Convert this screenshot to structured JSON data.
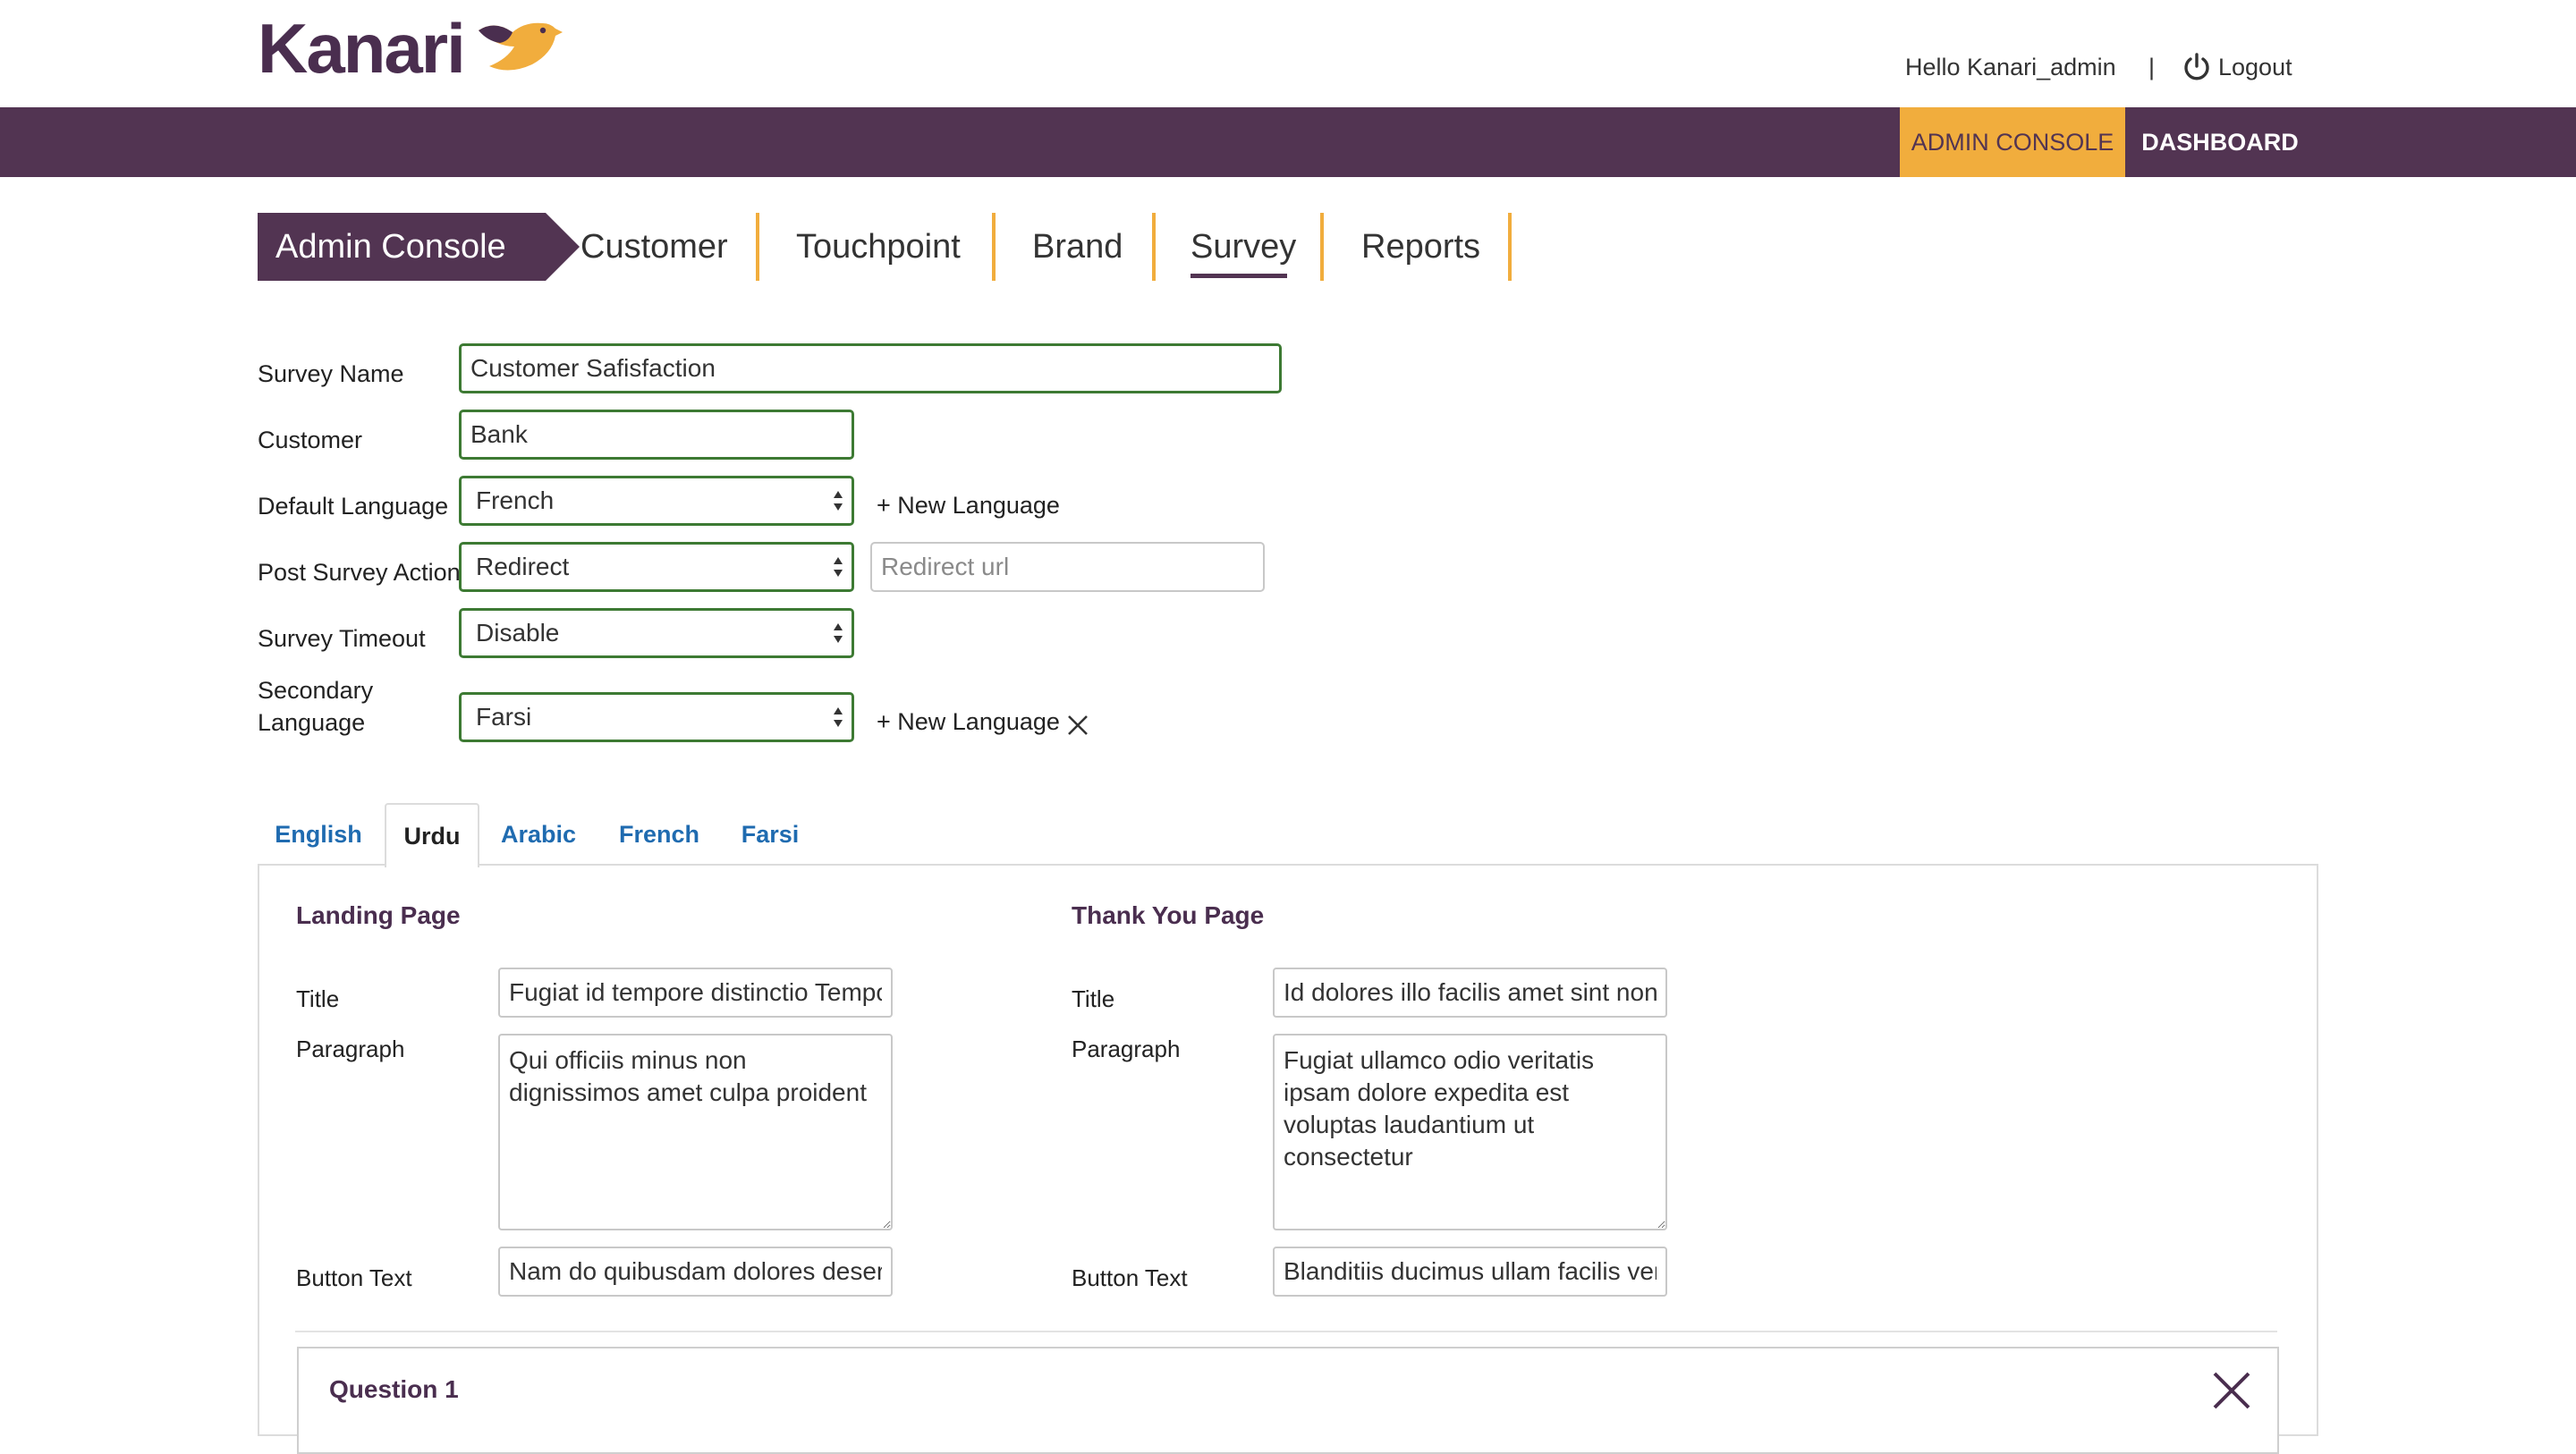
{
  "brand": {
    "logo_text": "Kanari",
    "accent": "#f1ad3d",
    "primary": "#523452",
    "valid_border": "#3d7a33",
    "link": "#1f6bb0"
  },
  "header": {
    "greeting": "Hello Kanari_admin",
    "separator": "|",
    "logout": "Logout",
    "icons": {
      "logout": "power-icon"
    }
  },
  "topnav": {
    "admin_console": "ADMIN CONSOLE",
    "dashboard": "DASHBOARD"
  },
  "subnav": {
    "breadcrumb": "Admin Console",
    "tabs": [
      "Customer",
      "Touchpoint",
      "Brand",
      "Survey",
      "Reports"
    ],
    "active_tab": "Survey"
  },
  "form": {
    "survey_name_label": "Survey Name",
    "survey_name_value": "Customer Safisfaction",
    "customer_label": "Customer",
    "customer_value": "Bank",
    "default_language_label": "Default Language",
    "default_language_value": "French",
    "new_language_link": "+ New Language",
    "post_survey_action_label": "Post Survey Action",
    "post_survey_action_value": "Redirect",
    "redirect_placeholder": "Redirect url",
    "survey_timeout_label": "Survey Timeout",
    "survey_timeout_value": "Disable",
    "secondary_language_label_1": "Secondary",
    "secondary_language_label_2": "Language",
    "secondary_language_value": "Farsi",
    "secondary_new_language_link": "+ New Language"
  },
  "language_tabs": {
    "items": [
      "English",
      "Urdu",
      "Arabic",
      "French",
      "Farsi"
    ],
    "active": "Urdu"
  },
  "landing": {
    "heading": "Landing Page",
    "title_label": "Title",
    "title_value": "Fugiat id tempore distinctio Tempor",
    "paragraph_label": "Paragraph",
    "paragraph_value": "Qui officiis minus non dignissimos amet culpa proident",
    "button_label": "Button Text",
    "button_value": "Nam do quibusdam dolores deserunt"
  },
  "thankyou": {
    "heading": "Thank You Page",
    "title_label": "Title",
    "title_value": "Id dolores illo facilis amet sint non",
    "paragraph_label": "Paragraph",
    "paragraph_value": "Fugiat ullamco odio veritatis ipsam dolore expedita est voluptas laudantium ut consectetur",
    "button_label": "Button Text",
    "button_value": "Blanditiis ducimus ullam facilis veniam"
  },
  "question": {
    "title": "Question 1"
  }
}
